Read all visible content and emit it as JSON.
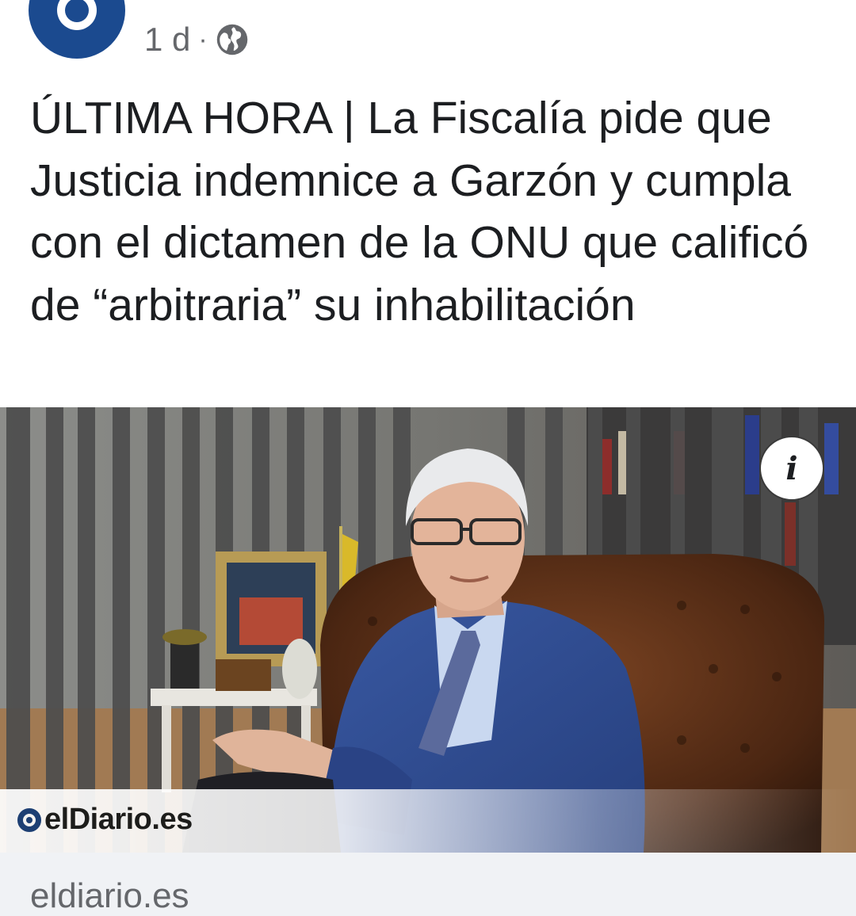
{
  "post": {
    "time": "1 d",
    "separator": "·",
    "privacy_icon": "globe-icon",
    "more_icon": "more-options-icon"
  },
  "headline": "ÚLTIMA HORA | La Fiscalía pide que Justicia indemnice a Garzón y cumpla con el dictamen de la ONU que calificó de “arbitraria” su inhabilitación",
  "link_preview": {
    "image_overlay_logo": "elDiario.es",
    "info_icon": "info-icon",
    "info_glyph": "i",
    "domain": "eldiario.es"
  },
  "colors": {
    "avatar_blue": "#1b4a8f",
    "text_primary": "#1c1e21",
    "text_secondary": "#65676b",
    "footer_bg": "#f0f2f5"
  }
}
